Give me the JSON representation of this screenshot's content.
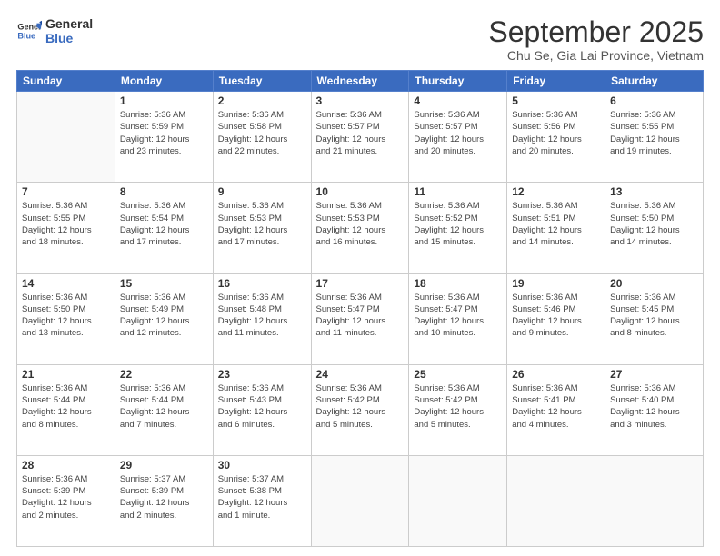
{
  "logo": {
    "line1": "General",
    "line2": "Blue"
  },
  "title": "September 2025",
  "subtitle": "Chu Se, Gia Lai Province, Vietnam",
  "days_of_week": [
    "Sunday",
    "Monday",
    "Tuesday",
    "Wednesday",
    "Thursday",
    "Friday",
    "Saturday"
  ],
  "weeks": [
    [
      {
        "day": "",
        "info": ""
      },
      {
        "day": "1",
        "info": "Sunrise: 5:36 AM\nSunset: 5:59 PM\nDaylight: 12 hours\nand 23 minutes."
      },
      {
        "day": "2",
        "info": "Sunrise: 5:36 AM\nSunset: 5:58 PM\nDaylight: 12 hours\nand 22 minutes."
      },
      {
        "day": "3",
        "info": "Sunrise: 5:36 AM\nSunset: 5:57 PM\nDaylight: 12 hours\nand 21 minutes."
      },
      {
        "day": "4",
        "info": "Sunrise: 5:36 AM\nSunset: 5:57 PM\nDaylight: 12 hours\nand 20 minutes."
      },
      {
        "day": "5",
        "info": "Sunrise: 5:36 AM\nSunset: 5:56 PM\nDaylight: 12 hours\nand 20 minutes."
      },
      {
        "day": "6",
        "info": "Sunrise: 5:36 AM\nSunset: 5:55 PM\nDaylight: 12 hours\nand 19 minutes."
      }
    ],
    [
      {
        "day": "7",
        "info": "Sunrise: 5:36 AM\nSunset: 5:55 PM\nDaylight: 12 hours\nand 18 minutes."
      },
      {
        "day": "8",
        "info": "Sunrise: 5:36 AM\nSunset: 5:54 PM\nDaylight: 12 hours\nand 17 minutes."
      },
      {
        "day": "9",
        "info": "Sunrise: 5:36 AM\nSunset: 5:53 PM\nDaylight: 12 hours\nand 17 minutes."
      },
      {
        "day": "10",
        "info": "Sunrise: 5:36 AM\nSunset: 5:53 PM\nDaylight: 12 hours\nand 16 minutes."
      },
      {
        "day": "11",
        "info": "Sunrise: 5:36 AM\nSunset: 5:52 PM\nDaylight: 12 hours\nand 15 minutes."
      },
      {
        "day": "12",
        "info": "Sunrise: 5:36 AM\nSunset: 5:51 PM\nDaylight: 12 hours\nand 14 minutes."
      },
      {
        "day": "13",
        "info": "Sunrise: 5:36 AM\nSunset: 5:50 PM\nDaylight: 12 hours\nand 14 minutes."
      }
    ],
    [
      {
        "day": "14",
        "info": "Sunrise: 5:36 AM\nSunset: 5:50 PM\nDaylight: 12 hours\nand 13 minutes."
      },
      {
        "day": "15",
        "info": "Sunrise: 5:36 AM\nSunset: 5:49 PM\nDaylight: 12 hours\nand 12 minutes."
      },
      {
        "day": "16",
        "info": "Sunrise: 5:36 AM\nSunset: 5:48 PM\nDaylight: 12 hours\nand 11 minutes."
      },
      {
        "day": "17",
        "info": "Sunrise: 5:36 AM\nSunset: 5:47 PM\nDaylight: 12 hours\nand 11 minutes."
      },
      {
        "day": "18",
        "info": "Sunrise: 5:36 AM\nSunset: 5:47 PM\nDaylight: 12 hours\nand 10 minutes."
      },
      {
        "day": "19",
        "info": "Sunrise: 5:36 AM\nSunset: 5:46 PM\nDaylight: 12 hours\nand 9 minutes."
      },
      {
        "day": "20",
        "info": "Sunrise: 5:36 AM\nSunset: 5:45 PM\nDaylight: 12 hours\nand 8 minutes."
      }
    ],
    [
      {
        "day": "21",
        "info": "Sunrise: 5:36 AM\nSunset: 5:44 PM\nDaylight: 12 hours\nand 8 minutes."
      },
      {
        "day": "22",
        "info": "Sunrise: 5:36 AM\nSunset: 5:44 PM\nDaylight: 12 hours\nand 7 minutes."
      },
      {
        "day": "23",
        "info": "Sunrise: 5:36 AM\nSunset: 5:43 PM\nDaylight: 12 hours\nand 6 minutes."
      },
      {
        "day": "24",
        "info": "Sunrise: 5:36 AM\nSunset: 5:42 PM\nDaylight: 12 hours\nand 5 minutes."
      },
      {
        "day": "25",
        "info": "Sunrise: 5:36 AM\nSunset: 5:42 PM\nDaylight: 12 hours\nand 5 minutes."
      },
      {
        "day": "26",
        "info": "Sunrise: 5:36 AM\nSunset: 5:41 PM\nDaylight: 12 hours\nand 4 minutes."
      },
      {
        "day": "27",
        "info": "Sunrise: 5:36 AM\nSunset: 5:40 PM\nDaylight: 12 hours\nand 3 minutes."
      }
    ],
    [
      {
        "day": "28",
        "info": "Sunrise: 5:36 AM\nSunset: 5:39 PM\nDaylight: 12 hours\nand 2 minutes."
      },
      {
        "day": "29",
        "info": "Sunrise: 5:37 AM\nSunset: 5:39 PM\nDaylight: 12 hours\nand 2 minutes."
      },
      {
        "day": "30",
        "info": "Sunrise: 5:37 AM\nSunset: 5:38 PM\nDaylight: 12 hours\nand 1 minute."
      },
      {
        "day": "",
        "info": ""
      },
      {
        "day": "",
        "info": ""
      },
      {
        "day": "",
        "info": ""
      },
      {
        "day": "",
        "info": ""
      }
    ]
  ]
}
